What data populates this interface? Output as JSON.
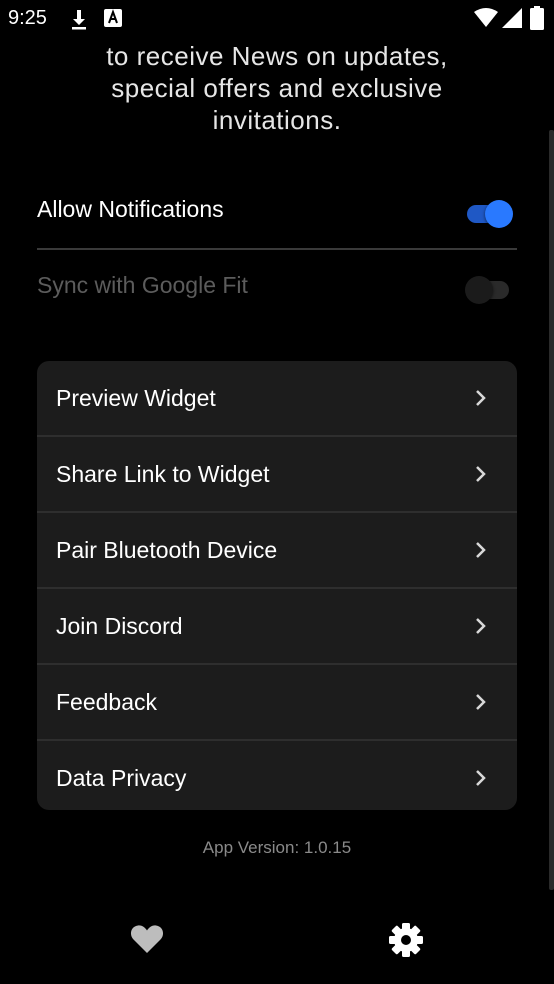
{
  "status_bar": {
    "time": "9:25",
    "icons": [
      "download-icon",
      "a-badge-icon",
      "wifi-icon",
      "signal-icon",
      "battery-icon"
    ]
  },
  "intro": {
    "lines": [
      "to receive News on updates,",
      "special offers and exclusive",
      "invitations."
    ]
  },
  "settings": {
    "notifications": {
      "label": "Allow Notifications",
      "enabled": true
    },
    "google_fit": {
      "label": "Sync with Google Fit",
      "enabled": false
    }
  },
  "menu": {
    "items": [
      {
        "label": "Preview Widget"
      },
      {
        "label": "Share Link to Widget"
      },
      {
        "label": "Pair Bluetooth Device"
      },
      {
        "label": "Join Discord"
      },
      {
        "label": "Feedback"
      },
      {
        "label": "Data Privacy"
      }
    ]
  },
  "footer": {
    "app_version": "App Version: 1.0.15"
  },
  "bottom_nav": {
    "items": [
      {
        "icon": "heart-icon",
        "selected": false
      },
      {
        "icon": "gear-icon",
        "selected": true
      }
    ]
  },
  "colors": {
    "accent": "#2979ff",
    "background": "#000000",
    "card": "#1c1c1c"
  }
}
